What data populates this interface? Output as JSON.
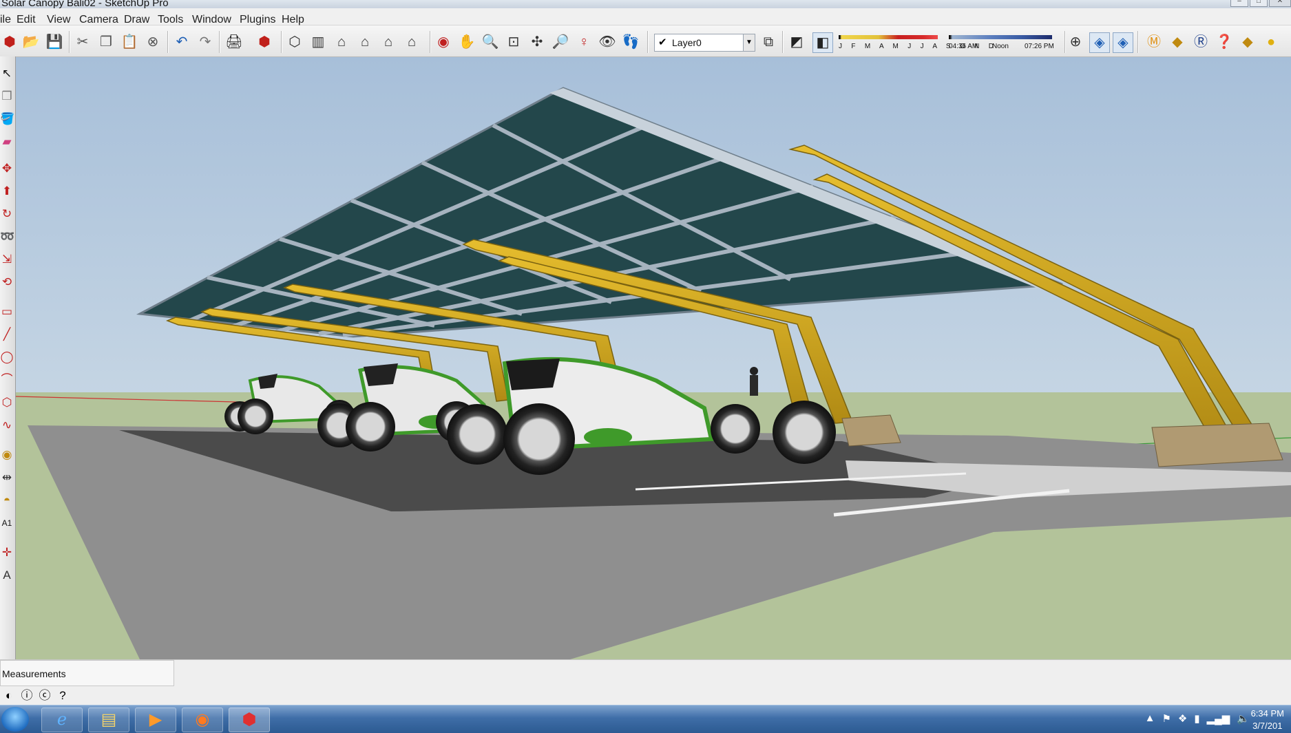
{
  "window": {
    "title": "Solar Canopy Bali02 - SketchUp Pro"
  },
  "menu": [
    "ile",
    "Edit",
    "View",
    "Camera",
    "Draw",
    "Tools",
    "Window",
    "Plugins",
    "Help"
  ],
  "toolbar": {
    "layer_name": "Layer0",
    "months_label": "J F M A M J J A S O N D",
    "time_start": "04:36 AM",
    "time_mid": "Noon",
    "time_end": "07:26 PM"
  },
  "status": {
    "measurements_label": "Measurements"
  },
  "taskbar": {
    "time": "6:34 PM",
    "date": "3/7/201"
  },
  "colors": {
    "sky_top": "#a7bfd9",
    "sky_bottom": "#dce6ec",
    "ground": "#b3c39a",
    "canopy_beam": "#d4a81e",
    "panel": "#214145",
    "frame": "#9aa8b6",
    "car_green": "#3f9a2a"
  },
  "icons": {
    "toolbar": [
      "sketchup-logo-icon",
      "open-icon",
      "save-icon",
      "cut-icon",
      "copy-icon",
      "paste-icon",
      "erase-icon",
      "undo-icon",
      "redo-icon",
      "print-icon",
      "model-info-icon",
      "iso-view-icon",
      "top-view-icon",
      "front-view-icon",
      "right-view-icon",
      "back-view-icon",
      "left-view-icon",
      "orbit-icon",
      "pan-icon",
      "zoom-icon",
      "zoom-window-icon",
      "zoom-extents-icon",
      "previous-view-icon",
      "position-camera-icon",
      "look-around-icon",
      "walk-icon",
      "layer-manager-icon",
      "shadows-icon",
      "fog-icon",
      "section-plane-icon",
      "display-section-icon",
      "show-section-cuts-icon",
      "m-plugin-icon",
      "tag-plugin-icon",
      "render-icon",
      "help-icon",
      "components-icon",
      "sun-icon"
    ],
    "left": [
      "select-icon",
      "make-component-icon",
      "paint-bucket-icon",
      "eraser-icon",
      "move-icon",
      "push-pull-icon",
      "rotate-icon",
      "follow-me-icon",
      "scale-icon",
      "offset-icon",
      "rectangle-icon",
      "line-icon",
      "circle-icon",
      "arc-icon",
      "polygon-icon",
      "freehand-icon",
      "tape-measure-icon",
      "dimension-icon",
      "protractor-icon",
      "text-icon",
      "axes-icon",
      "3d-text-icon"
    ],
    "status": [
      "geo-location-icon",
      "credits-icon",
      "user-icon",
      "help-icon"
    ],
    "taskbar": [
      "windows-start-icon",
      "internet-explorer-icon",
      "file-explorer-icon",
      "media-player-icon",
      "firefox-icon",
      "sketchup-taskbar-icon"
    ]
  }
}
